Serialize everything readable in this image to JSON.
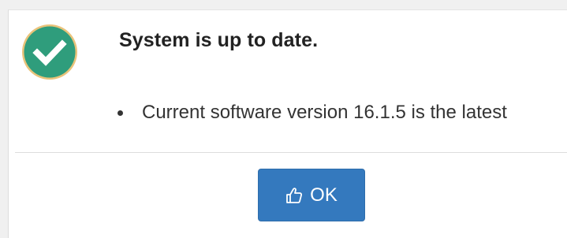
{
  "dialog": {
    "status_icon": "check-circle-icon",
    "title": "System is up to date.",
    "details": [
      "Current software version 16.1.5 is the latest"
    ],
    "ok_button": {
      "icon": "thumbs-up-icon",
      "label": "OK"
    }
  },
  "colors": {
    "success_green": "#2f9d7c",
    "button_blue": "#3479be",
    "title_text": "#222222",
    "body_text": "#333333"
  }
}
